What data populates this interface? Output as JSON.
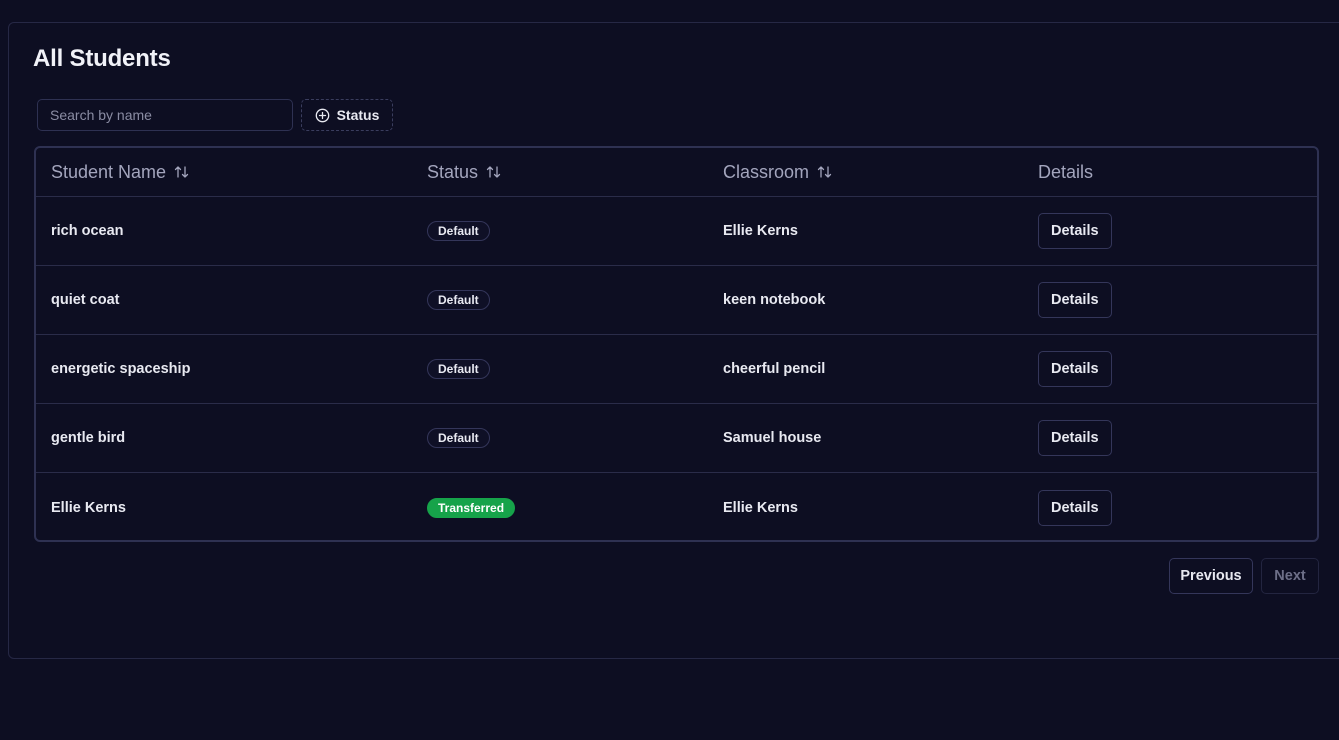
{
  "page": {
    "title": "All Students"
  },
  "toolbar": {
    "search_placeholder": "Search by name",
    "search_value": "",
    "status_filter_label": "Status",
    "status_filter_icon": "plus-circle-icon"
  },
  "table": {
    "columns": [
      {
        "label": "Student Name",
        "sortable": true
      },
      {
        "label": "Status",
        "sortable": true
      },
      {
        "label": "Classroom",
        "sortable": true
      },
      {
        "label": "Details",
        "sortable": false
      }
    ],
    "rows": [
      {
        "name": "rich ocean",
        "status": "Default",
        "classroom": "Ellie Kerns",
        "action": "Details"
      },
      {
        "name": "quiet coat",
        "status": "Default",
        "classroom": "keen notebook",
        "action": "Details"
      },
      {
        "name": "energetic spaceship",
        "status": "Default",
        "classroom": "cheerful pencil",
        "action": "Details"
      },
      {
        "name": "gentle bird",
        "status": "Default",
        "classroom": "Samuel house",
        "action": "Details"
      },
      {
        "name": "Ellie Kerns",
        "status": "Transferred",
        "classroom": "Ellie Kerns",
        "action": "Details"
      }
    ]
  },
  "pagination": {
    "previous_label": "Previous",
    "next_label": "Next",
    "next_disabled": true
  },
  "colors": {
    "background": "#0d0e22",
    "border": "#2e3152",
    "transferred_badge": "#16a34a"
  }
}
